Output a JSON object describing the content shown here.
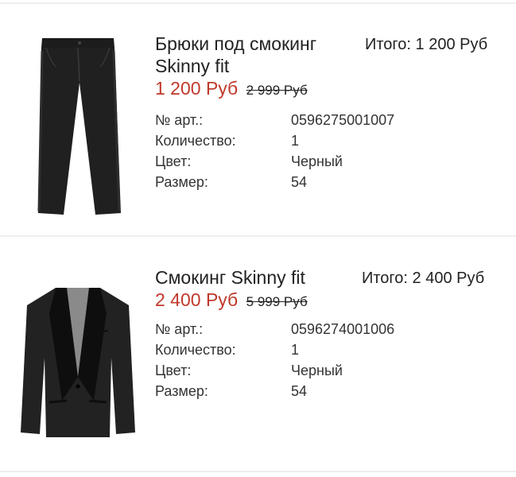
{
  "items": [
    {
      "image": "tuxedo-trousers-image",
      "name_line1": "Брюки под смокинг",
      "name_line2": "Skinny fit",
      "total_label": "Итого:",
      "total_value": "1 200 Руб",
      "price_current": "1 200 Руб",
      "price_old": "2 999 Руб",
      "details": [
        {
          "label": "№ арт.:",
          "value": "0596275001007"
        },
        {
          "label": "Количество:",
          "value": "1"
        },
        {
          "label": "Цвет:",
          "value": "Черный"
        },
        {
          "label": "Размер:",
          "value": "54"
        }
      ]
    },
    {
      "image": "tuxedo-jacket-image",
      "name_line1": "Смокинг Skinny fit",
      "total_label": "Итого:",
      "total_value": "2 400 Руб",
      "price_current": "2 400 Руб",
      "price_old": "5 999 Руб",
      "details": [
        {
          "label": "№ арт.:",
          "value": "0596274001006"
        },
        {
          "label": "Количество:",
          "value": "1"
        },
        {
          "label": "Цвет:",
          "value": "Черный"
        },
        {
          "label": "Размер:",
          "value": "54"
        }
      ]
    }
  ],
  "colors": {
    "sale_price": "#c0392b",
    "text": "#222222",
    "divider": "#eeeeee"
  }
}
